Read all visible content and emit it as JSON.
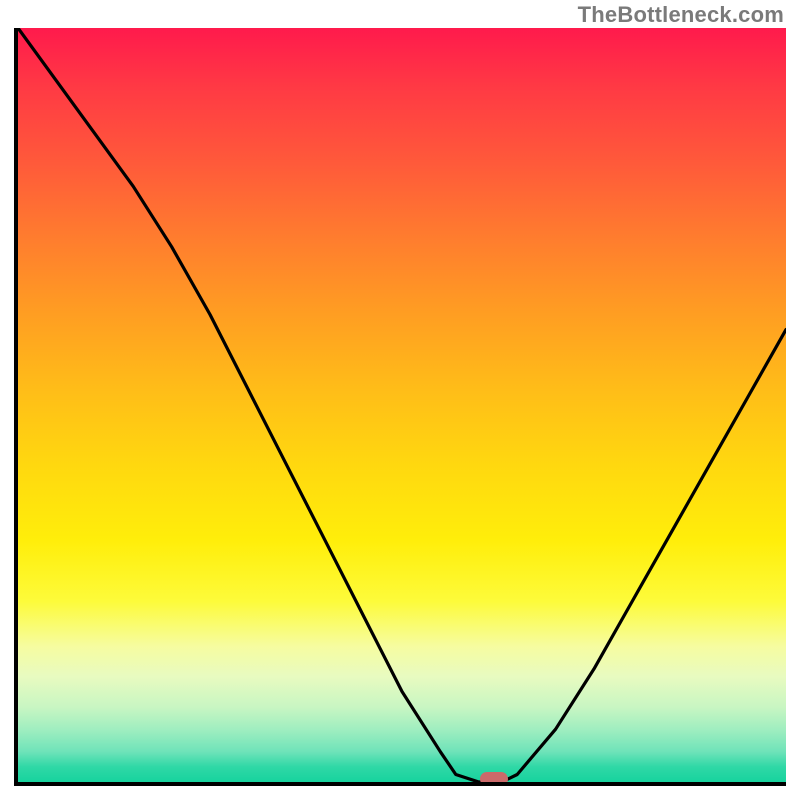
{
  "attribution": "TheBottleneck.com",
  "colors": {
    "axis": "#000000",
    "curve": "#000000",
    "marker": "#cc6a6a",
    "attribution_text": "#7a7a7a",
    "gradient_top": "#ff1a4c",
    "gradient_bottom": "#17d39e"
  },
  "chart_data": {
    "type": "line",
    "title": "",
    "xlabel": "",
    "ylabel": "",
    "xlim": [
      0,
      100
    ],
    "ylim": [
      0,
      100
    ],
    "x": [
      0,
      5,
      10,
      15,
      20,
      25,
      30,
      35,
      40,
      45,
      50,
      55,
      57,
      60,
      63,
      65,
      70,
      75,
      80,
      85,
      90,
      95,
      100
    ],
    "values": [
      100,
      93,
      86,
      79,
      71,
      62,
      52,
      42,
      32,
      22,
      12,
      4,
      1,
      0,
      0,
      1,
      7,
      15,
      24,
      33,
      42,
      51,
      60
    ],
    "marker": {
      "x": 62,
      "y": 0
    },
    "annotations": []
  }
}
